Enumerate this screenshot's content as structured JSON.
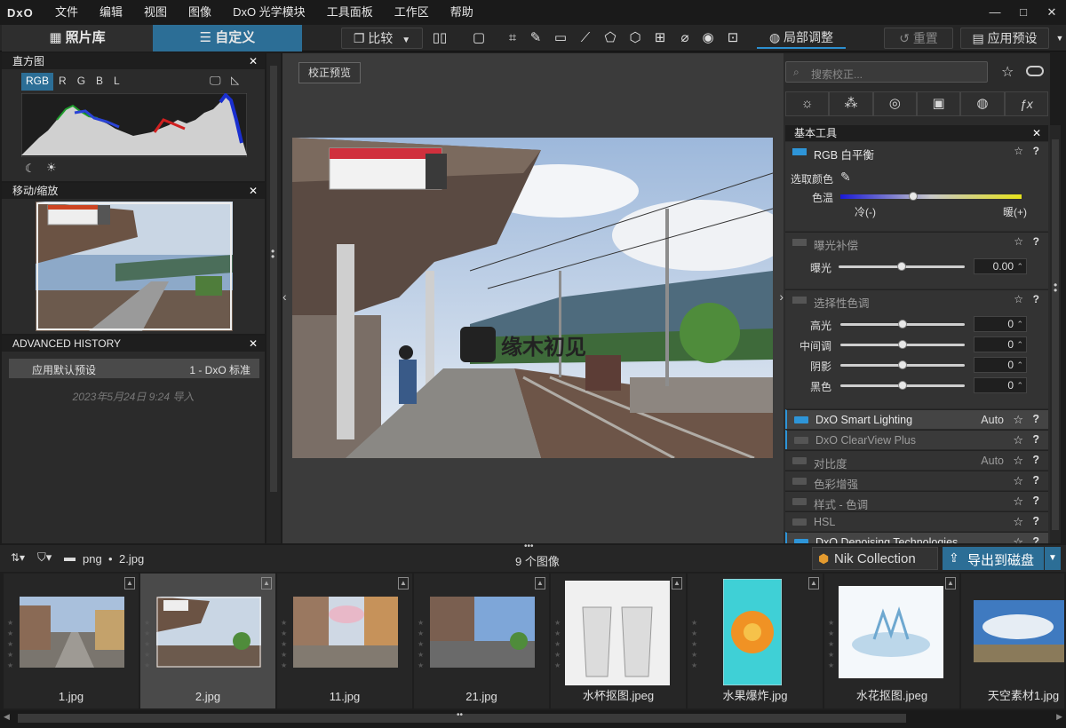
{
  "app": {
    "logo": "DxO"
  },
  "menu": [
    "文件",
    "编辑",
    "视图",
    "图像",
    "DxO 光学模块",
    "工具面板",
    "工作区",
    "帮助"
  ],
  "window_controls": {
    "minimize": "—",
    "maximize": "□",
    "close": "✕"
  },
  "toolbar": {
    "tab_library": "照片库",
    "tab_customize": "自定义",
    "compare": "比较",
    "local_adjust": "局部调整",
    "reset": "重置",
    "apply_preset": "应用预设"
  },
  "histogram": {
    "title": "直方图",
    "channels": [
      "RGB",
      "R",
      "G",
      "B",
      "L"
    ]
  },
  "navigator": {
    "title": "移动/缩放"
  },
  "history": {
    "title": "ADVANCED HISTORY",
    "row_left": "应用默认预设",
    "row_right": "1 - DxO 标准",
    "stamp": "2023年5月24日 9:24 导入"
  },
  "viewer": {
    "correct_preview": "校正预览",
    "watermark": "缘木初见"
  },
  "right": {
    "search_placeholder": "搜索校正...",
    "basic_tools": "基本工具",
    "wb_title": "RGB 白平衡",
    "pick_color": "选取颜色",
    "temp": "色温",
    "cold": "冷(-)",
    "warm": "暖(+)",
    "exposure_title": "曝光补偿",
    "exposure": "曝光",
    "exposure_val": "0.00",
    "tone_title": "选择性色调",
    "tone_rows": [
      {
        "label": "高光",
        "val": "0"
      },
      {
        "label": "中间调",
        "val": "0"
      },
      {
        "label": "阴影",
        "val": "0"
      },
      {
        "label": "黑色",
        "val": "0"
      }
    ],
    "tools": [
      {
        "name": "DxO Smart Lighting",
        "auto": "Auto",
        "on": true
      },
      {
        "name": "DxO ClearView Plus",
        "auto": "",
        "on": false
      },
      {
        "name": "对比度",
        "auto": "Auto",
        "on": false
      },
      {
        "name": "色彩增强",
        "auto": "",
        "on": false
      },
      {
        "name": "样式 - 色调",
        "auto": "",
        "on": false
      },
      {
        "name": "HSL",
        "auto": "",
        "on": false
      },
      {
        "name": "DxO Denoising Technologies",
        "auto": "",
        "on": true
      }
    ],
    "star": "☆",
    "q": "?"
  },
  "filmbar": {
    "path_folder": "png",
    "path_file": "2.jpg",
    "count": "9 个图像",
    "nik": "Nik Collection",
    "export": "导出到磁盘"
  },
  "thumbs": [
    "1.jpg",
    "2.jpg",
    "11.jpg",
    "21.jpg",
    "水杯抠图.jpeg",
    "水果爆炸.jpg",
    "水花抠图.jpeg",
    "天空素材1.jpg"
  ],
  "colors": {
    "accent": "#2c6e96",
    "tool_on": "#2e95d8"
  }
}
